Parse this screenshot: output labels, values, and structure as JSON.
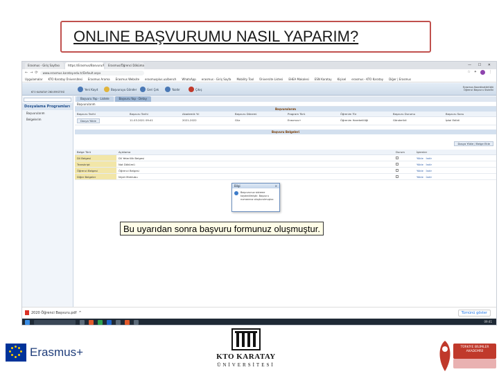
{
  "slide": {
    "title": "ONLINE BAŞVURUMU NASIL YAPARIM?",
    "caption": "Bu uyarıdan sonra başvuru formunuz oluşmuştur."
  },
  "browser": {
    "tabs": [
      "Erasmus - Giriş Sayfası",
      "https://Erasmus/Basvuru/Form",
      "Erasmus/Öğrenci Dökümanları"
    ],
    "url": "www.erasmus.karatay.edu.tr/Default.aspx",
    "bookmarks": [
      "Uygulamalar",
      "KTO Karatay Üniversitesi",
      "Erasmus Arama",
      "Erasmus Website",
      "erasmusplus.ua/bench",
      "WhatsApp",
      "erasmus - Giriş Sayfa",
      "Mobility Tool",
      "Üniversite Listesi",
      "EHEA Makalesi",
      "ESN Karatay",
      "Kişisel",
      "erasmus - KTO Karatay",
      "Diğer | Erasmus"
    ],
    "window_controls": "— ☐ ✕"
  },
  "app": {
    "logo_text": "KTO KARATAY ÜNİVERSİTESİ",
    "toolbar": [
      "Yeni Kayıt",
      "Başvuruyu Gönder",
      "Geri Çek",
      "Yazdır",
      "Çıkış"
    ],
    "user_info": [
      "Erasmus Koordinatörlüğü",
      "Öğrenci Başvuru Sistemi"
    ],
    "sidebar_head": "Dosyalama Programları",
    "sidebar_items": [
      "Başvurularım",
      "Belgelerim"
    ],
    "main_tabs": [
      "Başvuru Yap - Listele",
      "Başvuru Yap - Detay"
    ],
    "breadcrumb": "Başvurularım",
    "section_title": "Başvurularım",
    "form_headers": [
      "Başvuru Tarihi",
      "Başvuru Tarihi",
      "Akademik Yıl",
      "Başvuru Dönemi",
      "Program Türü",
      "Öğrenim Tür",
      "Başvuru Durumu",
      "Başvuru Sonu"
    ],
    "form_values": [
      "Dosya Yükle",
      "11.03.2021 09:41",
      "2021-2022",
      "Güz",
      "Erasmus+",
      "Öğrenim Hareketliliği",
      "Gönderildi",
      "İptal Edildi"
    ],
    "section2_title": "Başvuru Belgeleri",
    "upload_button": "Dosya Yükle / Belge Ekle",
    "table_headers": [
      "Belge Türü",
      "Açıklama",
      "Durum",
      "İşlemler"
    ],
    "rows": [
      {
        "type": "Dil Belgesi",
        "desc": "Dil Yeterlilik Belgesi",
        "action1": "Yükle",
        "action2": "İndir"
      },
      {
        "type": "Transkript",
        "desc": "Not Dökümü",
        "action1": "Yükle",
        "action2": "İndir"
      },
      {
        "type": "Öğrenci Belgesi",
        "desc": "Öğrenci Belgesi",
        "action1": "Yükle",
        "action2": "İndir"
      },
      {
        "type": "Diğer Belgeler",
        "desc": "Niyet Mektubu",
        "action1": "Yükle",
        "action2": "İndir"
      }
    ],
    "dialog_title": "Bilgi",
    "dialog_text": "Başvurunuz sisteme kaydedilmiştir. Başvuru numaranız oluşturulmuştur."
  },
  "downloads": {
    "file": "2020 Öğrenci Başvuru.pdf",
    "show_all": "Tümünü göster"
  },
  "taskbar": {
    "time": "09:41"
  },
  "logos": {
    "erasmus": "Erasmus+",
    "kto_name": "KTO KARATAY",
    "kto_sub": "ÜNİVERSİTESİ",
    "tuba_text": "TÜRKİYE BİLİMLER AKADEMİSİ"
  }
}
